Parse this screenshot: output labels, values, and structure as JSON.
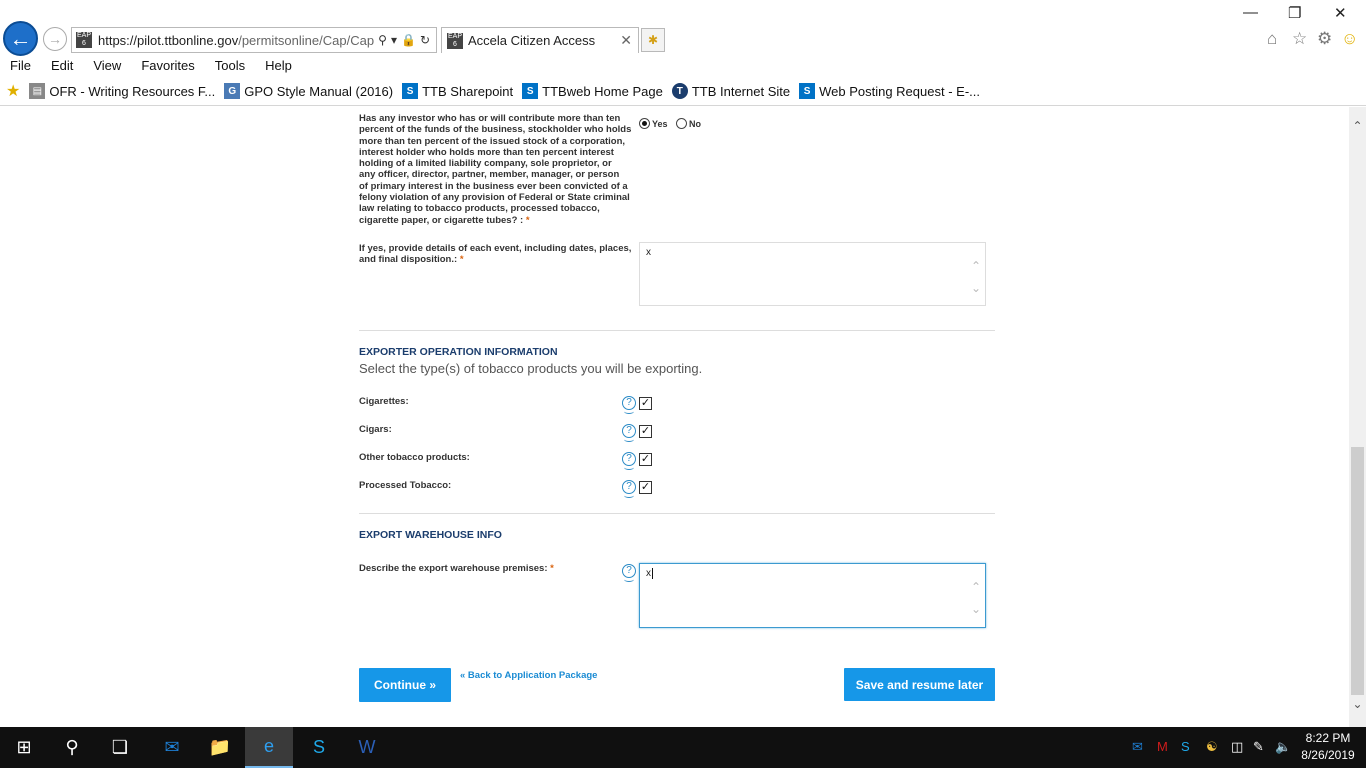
{
  "browser": {
    "url": "https://pilot.ttbonline.gov/permitsonline/Cap/Cap",
    "url_host": "https://pilot.ttbonline.gov",
    "url_path": "/permitsonline/Cap/Cap",
    "addr_badge": "EAP 6",
    "tab_title": "Accela Citizen Access",
    "tab_badge": "EAP 6",
    "menu": [
      "File",
      "Edit",
      "View",
      "Favorites",
      "Tools",
      "Help"
    ],
    "favorites": [
      {
        "label": "OFR - Writing Resources F...",
        "icon": "document-icon",
        "color": "#888888"
      },
      {
        "label": "GPO Style Manual (2016)",
        "icon": "gpo-icon",
        "color": "#4a7ab5"
      },
      {
        "label": "TTB Sharepoint",
        "icon": "sharepoint-icon",
        "color": "#0072c6"
      },
      {
        "label": "TTBweb Home Page",
        "icon": "sharepoint-icon",
        "color": "#0072c6"
      },
      {
        "label": "TTB Internet Site",
        "icon": "ttb-seal-icon",
        "color": "#1b3d6d"
      },
      {
        "label": "Web Posting Request - E-...",
        "icon": "sharepoint-icon",
        "color": "#0072c6"
      }
    ]
  },
  "form": {
    "felony_question": {
      "lines": [
        "Has any investor who has or will contribute more than ten",
        "percent of the funds of the business, stockholder who holds",
        "more than ten percent of the issued stock of a corporation,",
        "interest holder who holds more than ten percent interest",
        "holding of a limited liability company, sole proprietor, or",
        "any officer, director, partner, member, manager, or person",
        "of primary interest in the business ever been convicted of a",
        "felony violation of any provision of Federal or State criminal",
        "law relating to tobacco products, processed tobacco,",
        "cigarette paper, or cigarette tubes? :"
      ],
      "required_mark": "*",
      "options": [
        {
          "label": "Yes",
          "selected": true
        },
        {
          "label": "No",
          "selected": false
        }
      ]
    },
    "details_field": {
      "label_lines": [
        "If yes, provide details of each event, including dates, places,",
        "and final disposition.:"
      ],
      "required_mark": "*",
      "value": "x"
    },
    "exporter_section": {
      "heading": "EXPORTER OPERATION INFORMATION",
      "subheading": "Select the type(s) of tobacco products you will be exporting.",
      "items": [
        {
          "label": "Cigarettes:",
          "checked": true
        },
        {
          "label": "Cigars:",
          "checked": true
        },
        {
          "label": "Other tobacco products:",
          "checked": true
        },
        {
          "label": "Processed Tobacco:",
          "checked": true
        }
      ],
      "help_glyph": "?",
      "check_glyph": "✓"
    },
    "warehouse_section": {
      "heading": "EXPORT WAREHOUSE INFO",
      "field_label": "Describe the export warehouse premises:",
      "required_mark": "*",
      "value": "x"
    },
    "actions": {
      "continue_label": "Continue »",
      "back_link": "« Back to Application Package",
      "save_label": "Save and resume later"
    }
  },
  "taskbar": {
    "time": "8:22 PM",
    "date": "8/26/2019"
  }
}
